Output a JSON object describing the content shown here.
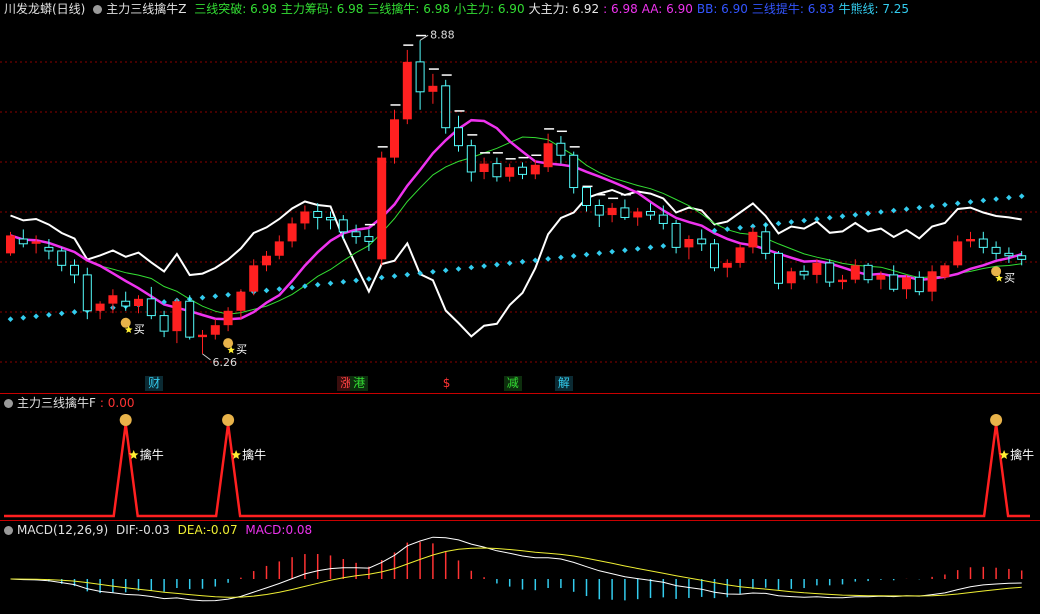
{
  "top": {
    "stock": "川发龙蟒(日线)",
    "indicator": "主力三线擒牛Z",
    "readouts": [
      {
        "label": "三线突破:",
        "value": "6.98",
        "color": "#33dd33"
      },
      {
        "label": "主力筹码:",
        "value": "6.98",
        "color": "#33dd33"
      },
      {
        "label": "三线擒牛:",
        "value": "6.98",
        "color": "#33dd33"
      },
      {
        "label": "小主力:",
        "value": "6.90",
        "color": "#33dd33"
      },
      {
        "label": "大主力:",
        "value": "6.92",
        "color": "#e8e8e8"
      },
      {
        "label": ":",
        "value": "6.98",
        "color": "#ee33ee"
      },
      {
        "label": "AA:",
        "value": "6.90",
        "color": "#ee33ee"
      },
      {
        "label": "BB:",
        "value": "6.90",
        "color": "#3355ff"
      },
      {
        "label": "三线提牛:",
        "value": "6.83",
        "color": "#3355ff"
      },
      {
        "label": "牛熊线:",
        "value": "7.25",
        "color": "#33ccee"
      }
    ],
    "price_high": "8.88",
    "price_low": "6.26",
    "buy_label": "买",
    "day_markers": [
      {
        "text": "财",
        "color": "#33ccee",
        "bg": "#0b2a33"
      },
      {
        "text": "涨",
        "color": "#ff4444",
        "bg": "#3a0d0d"
      },
      {
        "text": "港",
        "color": "#33dd33",
        "bg": "#0d2e0d"
      },
      {
        "text": "$",
        "color": "#ff3333",
        "bg": "#000000"
      },
      {
        "text": "减",
        "color": "#33dd33",
        "bg": "#0d2e0d"
      },
      {
        "text": "解",
        "color": "#33ccee",
        "bg": "#0b2a33"
      }
    ]
  },
  "mid": {
    "indicator": "主力三线擒牛F",
    "value": ": 0.00",
    "signal_label": "擒牛"
  },
  "macd": {
    "name": "MACD(12,26,9)",
    "dif_label": "DIF:",
    "dif": "-0.03",
    "dea_label": "DEA:",
    "dea": "-0.07",
    "macd_label": "MACD:",
    "macd": "0.08"
  },
  "colors": {
    "up": "#ff2020",
    "down": "#54fcfc",
    "mid_line": "#ee33ee",
    "green_line": "#33dd33",
    "white_line": "#ffffff",
    "dots": "#33ccee",
    "grid": "#8a0000"
  },
  "chart_data": {
    "type": "candlestick",
    "ohlc": [
      [
        7.1,
        7.28,
        7.08,
        7.25
      ],
      [
        7.22,
        7.3,
        7.15,
        7.18
      ],
      [
        7.18,
        7.25,
        7.1,
        7.2
      ],
      [
        7.15,
        7.22,
        7.05,
        7.12
      ],
      [
        7.12,
        7.15,
        6.95,
        7.0
      ],
      [
        7.0,
        7.05,
        6.85,
        6.92
      ],
      [
        6.92,
        6.98,
        6.55,
        6.62
      ],
      [
        6.62,
        6.7,
        6.55,
        6.68
      ],
      [
        6.68,
        6.8,
        6.6,
        6.75
      ],
      [
        6.7,
        6.78,
        6.62,
        6.66
      ],
      [
        6.66,
        6.75,
        6.6,
        6.72
      ],
      [
        6.72,
        6.82,
        6.55,
        6.58
      ],
      [
        6.58,
        6.62,
        6.4,
        6.45
      ],
      [
        6.45,
        6.72,
        6.35,
        6.7
      ],
      [
        6.7,
        6.75,
        6.38,
        6.4
      ],
      [
        6.4,
        6.46,
        6.26,
        6.42
      ],
      [
        6.42,
        6.55,
        6.38,
        6.5
      ],
      [
        6.5,
        6.65,
        6.45,
        6.62
      ],
      [
        6.62,
        6.8,
        6.55,
        6.78
      ],
      [
        6.78,
        7.05,
        6.75,
        7.0
      ],
      [
        7.0,
        7.12,
        6.95,
        7.08
      ],
      [
        7.08,
        7.25,
        7.05,
        7.2
      ],
      [
        7.2,
        7.4,
        7.15,
        7.35
      ],
      [
        7.35,
        7.5,
        7.3,
        7.45
      ],
      [
        7.45,
        7.52,
        7.3,
        7.4
      ],
      [
        7.4,
        7.45,
        7.3,
        7.38
      ],
      [
        7.38,
        7.42,
        7.22,
        7.28
      ],
      [
        7.28,
        7.34,
        7.18,
        7.24
      ],
      [
        7.24,
        7.3,
        7.12,
        7.2
      ],
      [
        7.05,
        7.95,
        7.0,
        7.9
      ],
      [
        7.9,
        8.3,
        7.85,
        8.22
      ],
      [
        8.22,
        8.8,
        8.18,
        8.7
      ],
      [
        8.7,
        8.88,
        8.3,
        8.45
      ],
      [
        8.45,
        8.6,
        8.35,
        8.5
      ],
      [
        8.5,
        8.55,
        8.1,
        8.15
      ],
      [
        8.15,
        8.25,
        7.95,
        8.0
      ],
      [
        8.0,
        8.05,
        7.7,
        7.78
      ],
      [
        7.78,
        7.9,
        7.72,
        7.85
      ],
      [
        7.85,
        7.9,
        7.7,
        7.74
      ],
      [
        7.74,
        7.85,
        7.7,
        7.82
      ],
      [
        7.82,
        7.86,
        7.72,
        7.76
      ],
      [
        7.76,
        7.88,
        7.72,
        7.84
      ],
      [
        7.82,
        8.1,
        7.78,
        8.02
      ],
      [
        8.02,
        8.08,
        7.85,
        7.92
      ],
      [
        7.92,
        7.95,
        7.6,
        7.65
      ],
      [
        7.65,
        7.62,
        7.45,
        7.5
      ],
      [
        7.5,
        7.55,
        7.32,
        7.42
      ],
      [
        7.42,
        7.52,
        7.36,
        7.48
      ],
      [
        7.48,
        7.55,
        7.38,
        7.4
      ],
      [
        7.4,
        7.48,
        7.33,
        7.45
      ],
      [
        7.45,
        7.52,
        7.38,
        7.42
      ],
      [
        7.42,
        7.5,
        7.3,
        7.35
      ],
      [
        7.35,
        7.38,
        7.1,
        7.15
      ],
      [
        7.15,
        7.25,
        7.05,
        7.22
      ],
      [
        7.22,
        7.3,
        7.12,
        7.18
      ],
      [
        7.18,
        7.22,
        6.95,
        6.98
      ],
      [
        6.98,
        7.05,
        6.9,
        7.02
      ],
      [
        7.02,
        7.18,
        6.98,
        7.15
      ],
      [
        7.15,
        7.32,
        7.1,
        7.28
      ],
      [
        7.28,
        7.35,
        7.05,
        7.1
      ],
      [
        7.1,
        7.12,
        6.8,
        6.85
      ],
      [
        6.85,
        6.98,
        6.8,
        6.95
      ],
      [
        6.95,
        7.0,
        6.88,
        6.92
      ],
      [
        6.92,
        7.05,
        6.85,
        7.02
      ],
      [
        7.02,
        7.05,
        6.82,
        6.86
      ],
      [
        6.86,
        6.92,
        6.8,
        6.88
      ],
      [
        6.88,
        7.05,
        6.85,
        7.0
      ],
      [
        7.0,
        7.02,
        6.85,
        6.88
      ],
      [
        6.88,
        6.95,
        6.8,
        6.92
      ],
      [
        6.92,
        7.0,
        6.78,
        6.8
      ],
      [
        6.8,
        6.92,
        6.72,
        6.9
      ],
      [
        6.9,
        6.95,
        6.75,
        6.78
      ],
      [
        6.78,
        7.0,
        6.7,
        6.95
      ],
      [
        6.9,
        7.02,
        6.88,
        7.0
      ],
      [
        7.0,
        7.25,
        6.98,
        7.2
      ],
      [
        7.2,
        7.28,
        7.15,
        7.22
      ],
      [
        7.22,
        7.28,
        7.1,
        7.15
      ],
      [
        7.15,
        7.2,
        7.05,
        7.1
      ],
      [
        7.1,
        7.15,
        7.02,
        7.08
      ],
      [
        7.08,
        7.12,
        7.0,
        7.05
      ]
    ],
    "signals_buy": [
      9,
      17,
      77
    ],
    "signals_qinniu": [
      9,
      17,
      77
    ]
  }
}
